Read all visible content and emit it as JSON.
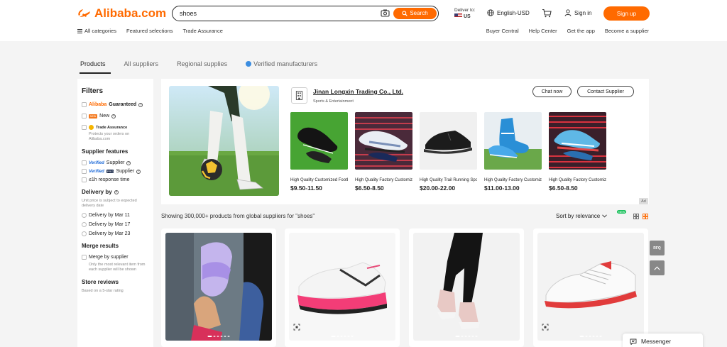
{
  "header": {
    "logo_text": "Alibaba.com",
    "search_value": "shoes",
    "search_button": "Search",
    "deliver_label": "Deliver to:",
    "deliver_country": "US",
    "language": "English-USD",
    "sign_in": "Sign in",
    "sign_up": "Sign up",
    "brand_color": "#ff6a00"
  },
  "nav": {
    "left": [
      "All categories",
      "Featured selections",
      "Trade Assurance"
    ],
    "right": [
      "Buyer Central",
      "Help Center",
      "Get the app",
      "Become a supplier"
    ]
  },
  "tabs": [
    "Products",
    "All suppliers",
    "Regional supplies",
    "Verified manufacturers"
  ],
  "filters": {
    "title": "Filters",
    "guaranteed_brand": "Alibaba",
    "guaranteed_word": "Guaranteed",
    "new_badge": "NEW",
    "new_label": "New",
    "trade_assurance": "Trade Assurance",
    "trade_assurance_note": "Protects your orders on Alibaba.com",
    "supplier_features": "Supplier features",
    "verified_word": "Verified",
    "pro_badge": "PRO",
    "supplier_word": "Supplier",
    "response_time": "≤1h response time",
    "delivery_by": "Delivery by",
    "delivery_note": "Unit price is subject to expected delivery date",
    "delivery_options": [
      "Delivery by Mar 11",
      "Delivery by Mar 17",
      "Delivery by Mar 23"
    ],
    "merge_results": "Merge results",
    "merge_by_supplier": "Merge by supplier",
    "merge_note": "Only the most relevant item from each supplier will be shown",
    "store_reviews": "Store reviews",
    "store_reviews_note": "Based on a 5-star rating"
  },
  "ad": {
    "company_name": "Jinan Longxin Trading Co., Ltd.",
    "company_category": "Sports & Entertainment",
    "chat_now": "Chat now",
    "contact_supplier": "Contact Supplier",
    "ad_tag": "Ad",
    "products": [
      {
        "name": "High Quality Customized Football...",
        "price": "$9.50-11.50",
        "icon": "black-football-boot"
      },
      {
        "name": "High Quality Factory Customized Hot Sellin...",
        "price": "$6.50-8.50",
        "icon": "white-football-boot"
      },
      {
        "name": "High Quality Trail Running Sports Shoes...",
        "price": "$20.00-22.00",
        "icon": "black-trail-shoe"
      },
      {
        "name": "High Quality Factory Customized Hot Sellin...",
        "price": "$11.00-13.00",
        "icon": "blue-football-boot"
      },
      {
        "name": "High Quality Factory Customized Hot Sellin...",
        "price": "$6.50-8.50",
        "icon": "blue-red-football-boot"
      }
    ]
  },
  "results": {
    "summary": "Showing 300,000+ products from global suppliers for \"shoes\"",
    "sort_label": "Sort by relevance",
    "new_tag": "NEW"
  },
  "side": {
    "rfq_label": "RFQ"
  },
  "messenger": "Messenger"
}
